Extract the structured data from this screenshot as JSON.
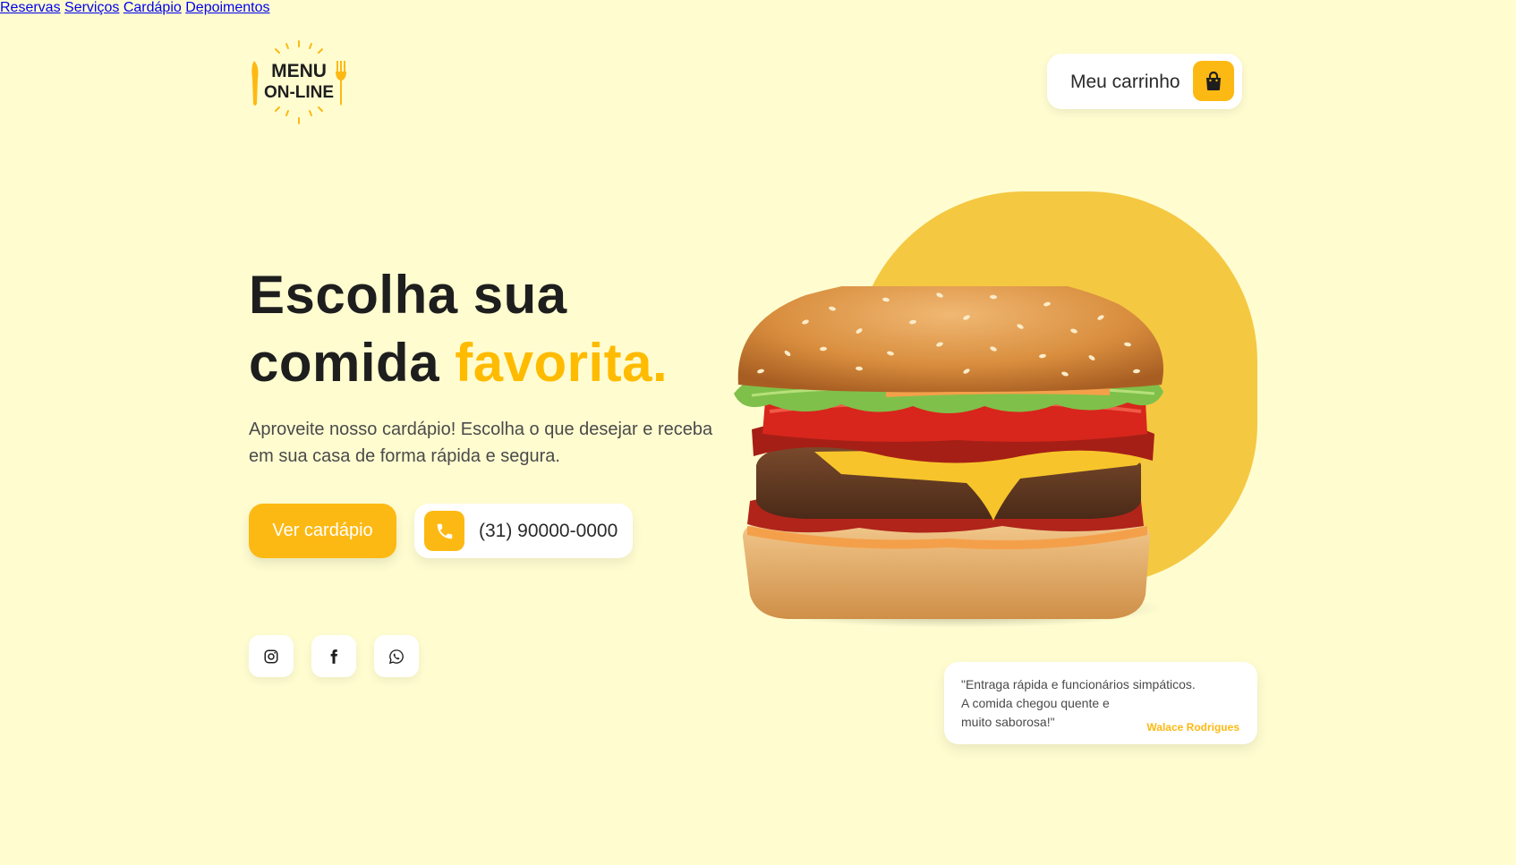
{
  "brand": {
    "logo_line1": "MENU",
    "logo_line2": "ON-LINE",
    "primary_color": "#fdb913",
    "background_color": "#fffdd0",
    "blob_color": "#f5c842"
  },
  "nav": {
    "items": [
      {
        "label": "Reservas"
      },
      {
        "label": "Serviços"
      },
      {
        "label": "Cardápio"
      },
      {
        "label": "Depoimentos"
      }
    ]
  },
  "cart": {
    "label": "Meu carrinho",
    "icon": "shopping-bag-icon"
  },
  "hero": {
    "title_line1": "Escolha sua",
    "title_line2_plain": "comida",
    "title_line2_accent": "favorita.",
    "description": "Aproveite nosso cardápio! Escolha o que desejar e receba em sua casa de forma rápida e segura.",
    "menu_button_label": "Ver cardápio",
    "phone_number": "(31) 90000-0000",
    "phone_icon": "phone-icon"
  },
  "social": {
    "items": [
      {
        "icon": "instagram-icon"
      },
      {
        "icon": "facebook-icon"
      },
      {
        "icon": "whatsapp-icon"
      }
    ]
  },
  "testimonial": {
    "text": "\"Entraga rápida e funcionários simpáticos.\nA comida chegou quente e\nmuito saborosa!\"",
    "author": "Walace Rodrigues"
  }
}
